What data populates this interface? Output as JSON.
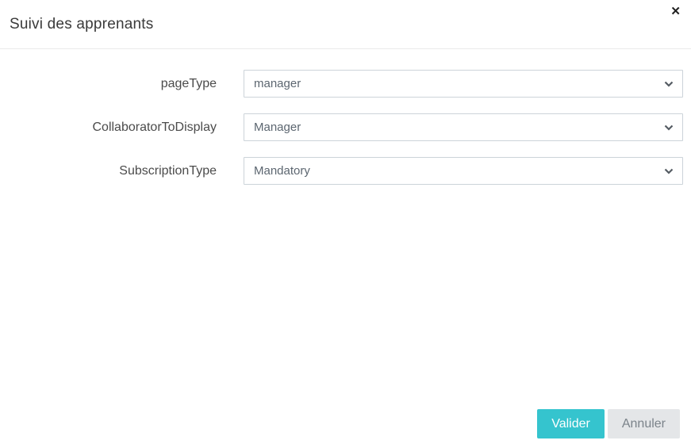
{
  "modal": {
    "title": "Suivi des apprenants"
  },
  "icons": {
    "close": "✕",
    "chevron": "chevron-down"
  },
  "form": {
    "fields": [
      {
        "label": "pageType",
        "value": "manager"
      },
      {
        "label": "CollaboratorToDisplay",
        "value": "Manager"
      },
      {
        "label": "SubscriptionType",
        "value": "Mandatory"
      }
    ]
  },
  "footer": {
    "submit_label": "Valider",
    "cancel_label": "Annuler"
  },
  "colors": {
    "accent": "#35c4ce",
    "cancel_bg": "#e4e6e8",
    "cancel_text": "#7b838a",
    "select_border": "#ccd3d9",
    "divider": "#eaeaea"
  }
}
